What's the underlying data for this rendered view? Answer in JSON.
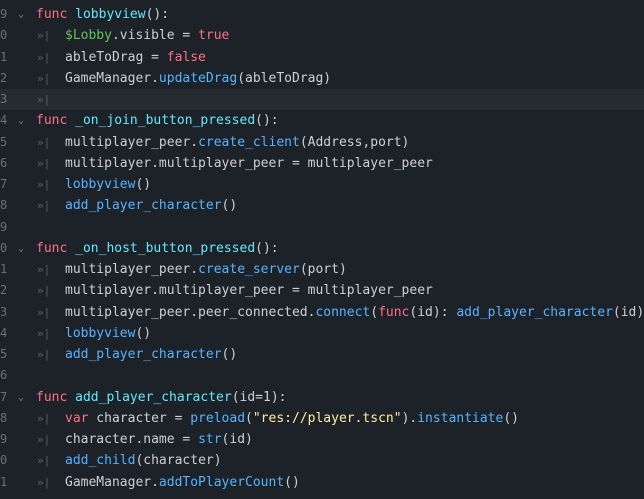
{
  "colors": {
    "background": "#1d2229",
    "current_line": "#262b32",
    "keyword": "#ff7085",
    "function_name": "#66e6ff",
    "call": "#57b3ff",
    "node_path": "#63c259",
    "string": "#ffeda1",
    "text": "#cdcfd2",
    "line_number": "#6b7078"
  },
  "icons": {
    "fold": "chevron-down-icon",
    "tab": "tab-indent-icon"
  },
  "lines": [
    {
      "num": "9",
      "fold": true,
      "tokens": [
        {
          "t": "func",
          "c": "kw"
        },
        {
          "t": " ",
          "c": "plain"
        },
        {
          "t": "lobbyview",
          "c": "fn"
        },
        {
          "t": "():",
          "c": "plain"
        }
      ]
    },
    {
      "num": "0",
      "indent": true,
      "tokens": [
        {
          "t": "$Lobby",
          "c": "node"
        },
        {
          "t": ".visible = ",
          "c": "plain"
        },
        {
          "t": "true",
          "c": "bool"
        }
      ]
    },
    {
      "num": "1",
      "indent": true,
      "tokens": [
        {
          "t": "ableToDrag = ",
          "c": "plain"
        },
        {
          "t": "false",
          "c": "bool"
        }
      ]
    },
    {
      "num": "2",
      "indent": true,
      "tokens": [
        {
          "t": "GameManager.",
          "c": "plain"
        },
        {
          "t": "updateDrag",
          "c": "call"
        },
        {
          "t": "(ableToDrag)",
          "c": "plain"
        }
      ]
    },
    {
      "num": "3",
      "current": true,
      "tab_only": true,
      "tokens": []
    },
    {
      "num": "4",
      "fold": true,
      "tokens": [
        {
          "t": "func",
          "c": "kw"
        },
        {
          "t": " ",
          "c": "plain"
        },
        {
          "t": "_on_join_button_pressed",
          "c": "fn"
        },
        {
          "t": "():",
          "c": "plain"
        }
      ]
    },
    {
      "num": "5",
      "indent": true,
      "tokens": [
        {
          "t": "multiplayer_peer.",
          "c": "plain"
        },
        {
          "t": "create_client",
          "c": "call"
        },
        {
          "t": "(Address,port)",
          "c": "plain"
        }
      ]
    },
    {
      "num": "6",
      "indent": true,
      "tokens": [
        {
          "t": "multiplayer.multiplayer_peer = multiplayer_peer",
          "c": "plain"
        }
      ]
    },
    {
      "num": "7",
      "indent": true,
      "tokens": [
        {
          "t": "lobbyview",
          "c": "call"
        },
        {
          "t": "()",
          "c": "plain"
        }
      ]
    },
    {
      "num": "8",
      "indent": true,
      "tokens": [
        {
          "t": "add_player_character",
          "c": "call"
        },
        {
          "t": "()",
          "c": "plain"
        }
      ]
    },
    {
      "num": "9",
      "tokens": []
    },
    {
      "num": "0",
      "fold": true,
      "tokens": [
        {
          "t": "func",
          "c": "kw"
        },
        {
          "t": " ",
          "c": "plain"
        },
        {
          "t": "_on_host_button_pressed",
          "c": "fn"
        },
        {
          "t": "():",
          "c": "plain"
        }
      ]
    },
    {
      "num": "1",
      "indent": true,
      "tokens": [
        {
          "t": "multiplayer_peer.",
          "c": "plain"
        },
        {
          "t": "create_server",
          "c": "call"
        },
        {
          "t": "(port)",
          "c": "plain"
        }
      ]
    },
    {
      "num": "2",
      "indent": true,
      "tokens": [
        {
          "t": "multiplayer.multiplayer_peer = multiplayer_peer",
          "c": "plain"
        }
      ]
    },
    {
      "num": "3",
      "indent": true,
      "tokens": [
        {
          "t": "multiplayer_peer.peer_connected.",
          "c": "plain"
        },
        {
          "t": "connect",
          "c": "call"
        },
        {
          "t": "(",
          "c": "plain"
        },
        {
          "t": "func",
          "c": "kw"
        },
        {
          "t": "(id): ",
          "c": "plain"
        },
        {
          "t": "add_player_character",
          "c": "call"
        },
        {
          "t": "(id))",
          "c": "plain"
        }
      ]
    },
    {
      "num": "4",
      "indent": true,
      "tokens": [
        {
          "t": "lobbyview",
          "c": "call"
        },
        {
          "t": "()",
          "c": "plain"
        }
      ]
    },
    {
      "num": "5",
      "indent": true,
      "tokens": [
        {
          "t": "add_player_character",
          "c": "call"
        },
        {
          "t": "()",
          "c": "plain"
        }
      ]
    },
    {
      "num": "6",
      "tokens": []
    },
    {
      "num": "7",
      "fold": true,
      "tokens": [
        {
          "t": "func",
          "c": "kw"
        },
        {
          "t": " ",
          "c": "plain"
        },
        {
          "t": "add_player_character",
          "c": "fn"
        },
        {
          "t": "(id=1):",
          "c": "plain"
        }
      ]
    },
    {
      "num": "8",
      "indent": true,
      "tokens": [
        {
          "t": "var",
          "c": "kw"
        },
        {
          "t": " character = ",
          "c": "plain"
        },
        {
          "t": "preload",
          "c": "call"
        },
        {
          "t": "(",
          "c": "plain"
        },
        {
          "t": "\"res://player.tscn\"",
          "c": "str"
        },
        {
          "t": ").",
          "c": "plain"
        },
        {
          "t": "instantiate",
          "c": "call"
        },
        {
          "t": "()",
          "c": "plain"
        }
      ]
    },
    {
      "num": "9",
      "indent": true,
      "tokens": [
        {
          "t": "character.name = ",
          "c": "plain"
        },
        {
          "t": "str",
          "c": "call"
        },
        {
          "t": "(id)",
          "c": "plain"
        }
      ]
    },
    {
      "num": "0",
      "indent": true,
      "tokens": [
        {
          "t": "add_child",
          "c": "call"
        },
        {
          "t": "(character)",
          "c": "plain"
        }
      ]
    },
    {
      "num": "1",
      "indent": true,
      "tokens": [
        {
          "t": "GameManager.",
          "c": "plain"
        },
        {
          "t": "addToPlayerCount",
          "c": "call"
        },
        {
          "t": "()",
          "c": "plain"
        }
      ]
    }
  ]
}
